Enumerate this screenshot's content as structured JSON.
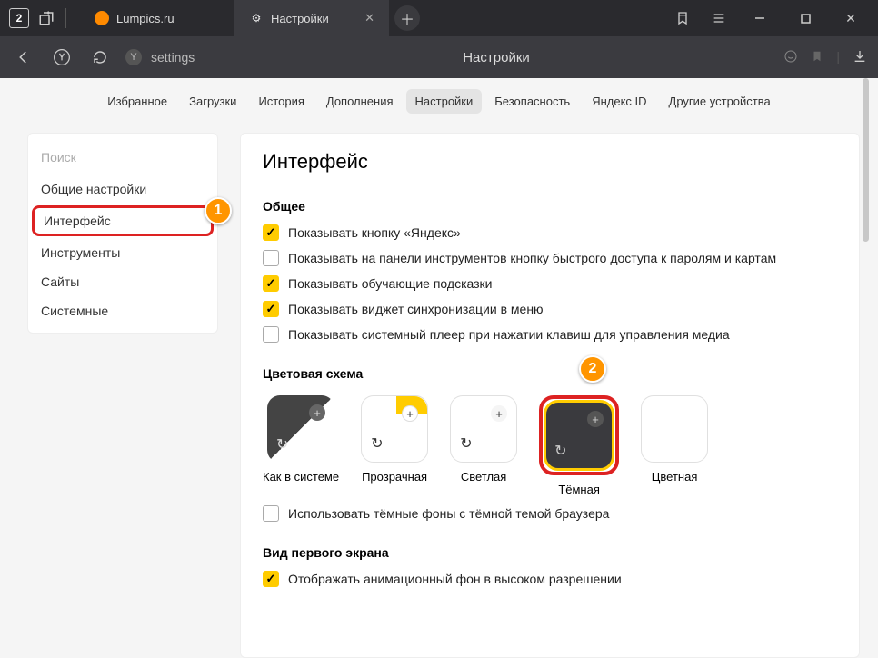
{
  "titlebar": {
    "tab_count": "2",
    "tabs": [
      {
        "label": "Lumpics.ru",
        "favicon_color": "#ff8a00"
      },
      {
        "label": "Настройки",
        "favicon_glyph": "⚙"
      }
    ]
  },
  "toolbar": {
    "url_text": "settings",
    "page_title": "Настройки"
  },
  "topnav": {
    "items": [
      "Избранное",
      "Загрузки",
      "История",
      "Дополнения",
      "Настройки",
      "Безопасность",
      "Яндекс ID",
      "Другие устройства"
    ],
    "active_index": 4
  },
  "sidebar": {
    "search_placeholder": "Поиск",
    "items": [
      "Общие настройки",
      "Интерфейс",
      "Инструменты",
      "Сайты",
      "Системные"
    ],
    "highlight_index": 1
  },
  "panel": {
    "heading": "Интерфейс",
    "sections": {
      "general": {
        "title": "Общее",
        "checks": [
          {
            "checked": true,
            "label": "Показывать кнопку «Яндекс»"
          },
          {
            "checked": false,
            "label": "Показывать на панели инструментов кнопку быстрого доступа к паролям и картам"
          },
          {
            "checked": true,
            "label": "Показывать обучающие подсказки"
          },
          {
            "checked": true,
            "label": "Показывать виджет синхронизации в меню"
          },
          {
            "checked": false,
            "label": "Показывать системный плеер при нажатии клавиш для управления медиа"
          }
        ]
      },
      "color_scheme": {
        "title": "Цветовая схема",
        "themes": [
          "Как в системе",
          "Прозрачная",
          "Светлая",
          "Тёмная",
          "Цветная"
        ],
        "selected_index": 3,
        "highlight_index": 3,
        "dark_bg_check": {
          "checked": false,
          "label": "Использовать тёмные фоны с тёмной темой браузера"
        }
      },
      "first_screen": {
        "title": "Вид первого экрана",
        "checks": [
          {
            "checked": true,
            "label": "Отображать анимационный фон в высоком разрешении"
          }
        ]
      }
    }
  },
  "callouts": {
    "one": "1",
    "two": "2"
  }
}
